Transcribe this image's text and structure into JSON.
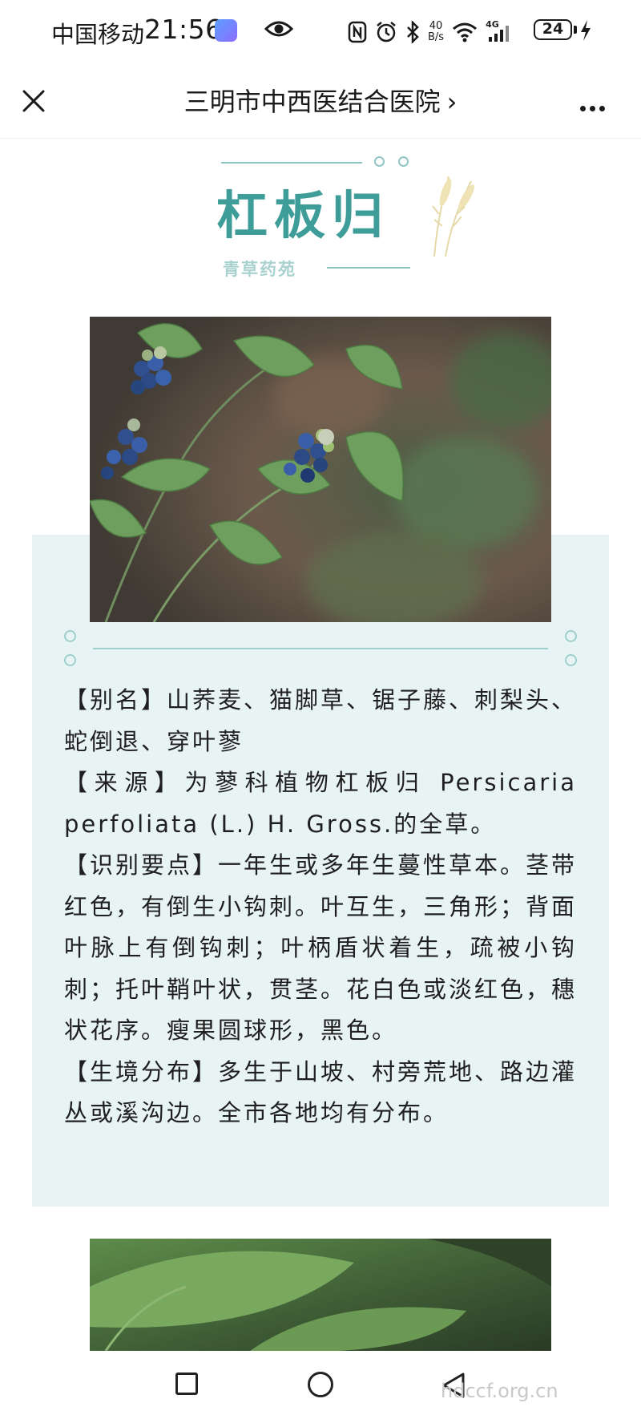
{
  "status_bar": {
    "carrier": "中国移动",
    "time": "21:56",
    "net_speed_value": "40",
    "net_speed_unit": "B/s",
    "signal_label": "4G",
    "battery": "24"
  },
  "nav": {
    "title": "三明市中西医结合医院",
    "chevron": "›"
  },
  "heading": {
    "title": "杠板归",
    "subtitle": "青草药苑"
  },
  "info": {
    "alias": "【别名】山荞麦、猫脚草、锯子藤、刺梨头、蛇倒退、穿叶蓼",
    "source": "【来源】为蓼科植物杠板归 Persicaria perfoliata (L.) H. Gross.的全草。",
    "identification": "【识别要点】一年生或多年生蔓性草本。茎带红色，有倒生小钩刺。叶互生，三角形；背面叶脉上有倒钩刺；叶柄盾状着生，疏被小钩刺；托叶鞘叶状，贯茎。花白色或淡红色，穗状花序。瘦果圆球形，黑色。",
    "habitat": "【生境分布】多生于山坡、村旁荒地、路边灌丛或溪沟边。全市各地均有分布。"
  },
  "watermark": "hdccf.org.cn",
  "icons": {
    "close": "close-icon",
    "more": "more-icon",
    "eye": "eye-icon",
    "wheat": "wheat-icon"
  },
  "colors": {
    "accent": "#3e9d98",
    "subtitle": "#a9d2cf",
    "panel_bg": "#e8f3f4",
    "deco": "#8fc6c3"
  }
}
